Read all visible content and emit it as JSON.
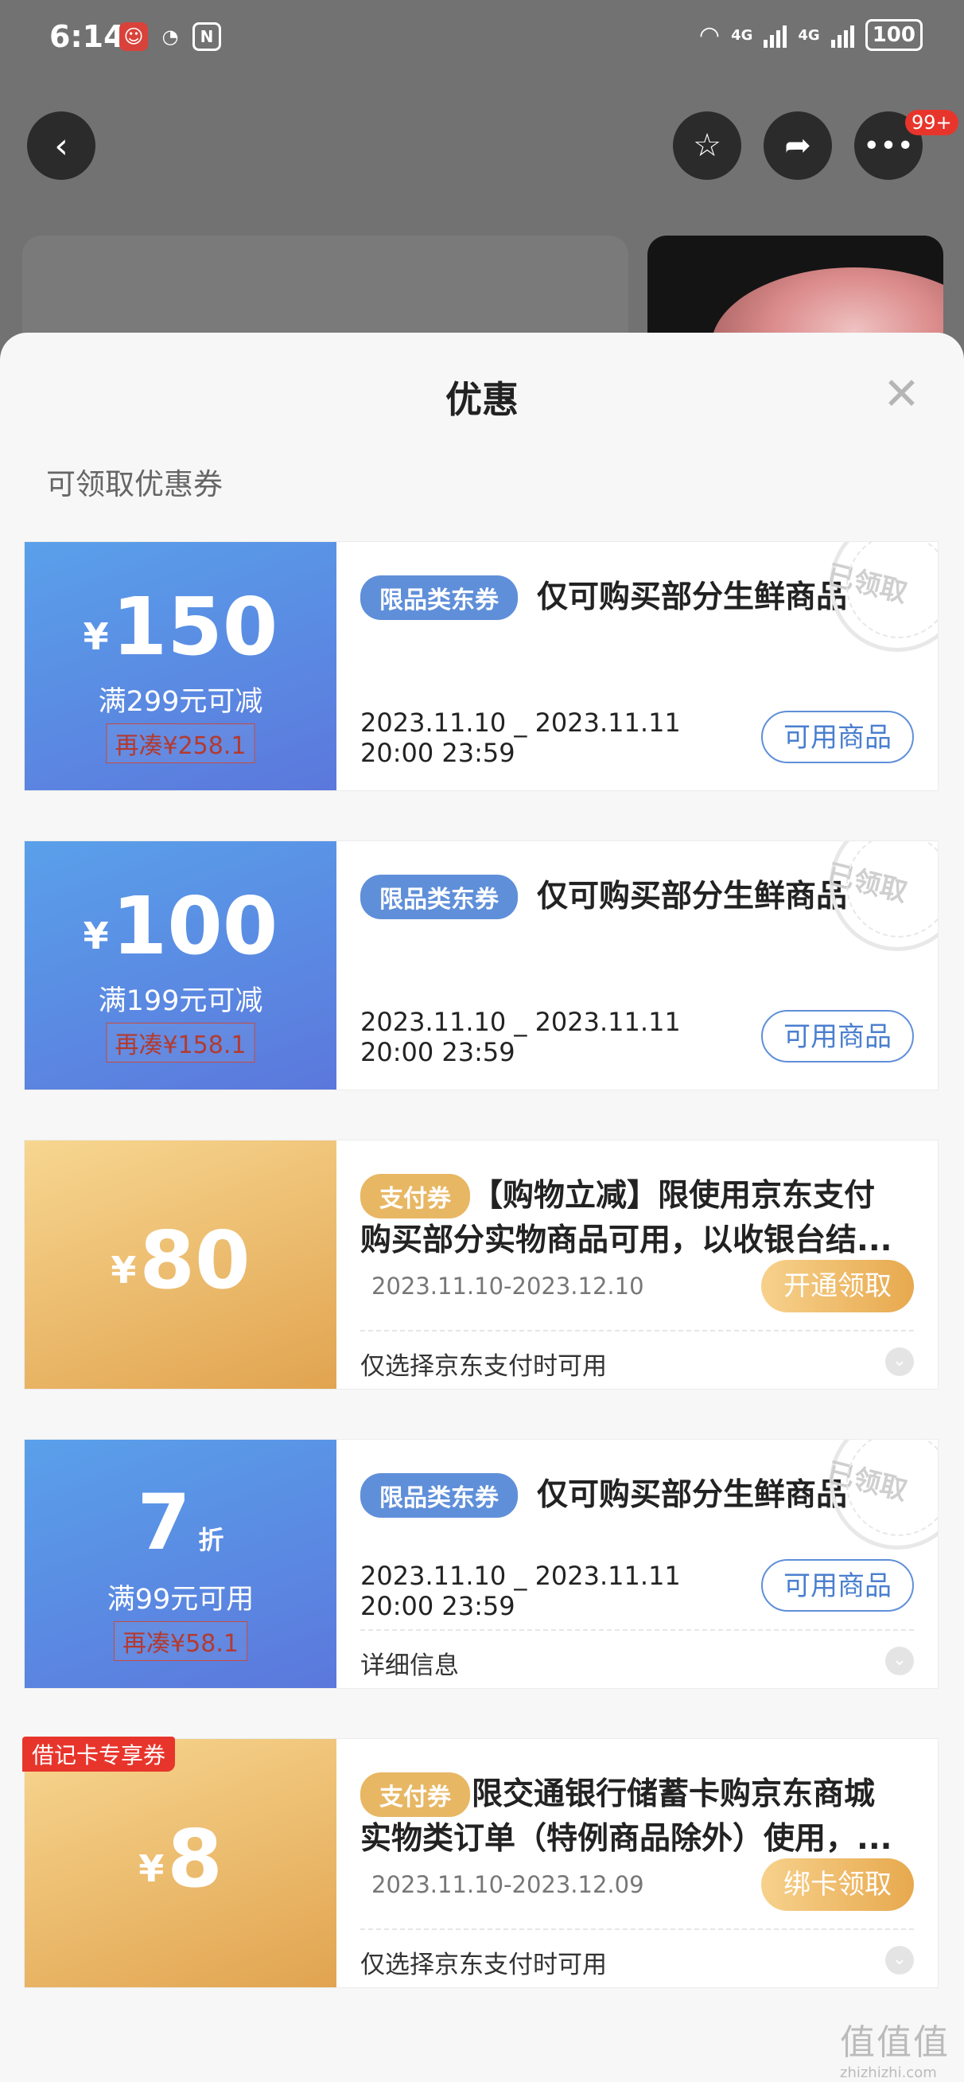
{
  "status_bar": {
    "time": "6:14",
    "app_icons": [
      "app-badge-icon",
      "speedometer-icon",
      "nfc-icon"
    ],
    "network_1": "4G",
    "network_2": "4G",
    "battery": "100"
  },
  "header": {
    "back_icon": "back-arrow-icon",
    "favorite_icon": "star-icon",
    "share_icon": "share-icon",
    "more_icon": "more-dots-icon",
    "more_badge": "99+"
  },
  "sheet": {
    "title": "优惠",
    "close_icon": "close-icon",
    "section_title": "可领取优惠券",
    "coupons": [
      {
        "currency": "¥",
        "amount": "150",
        "condition": "满299元可减",
        "gap": "再凑¥258.1",
        "tag": "限品类东券",
        "title": "仅可购买部分生鲜商品",
        "date_line1": "2023.11.10 _ 2023.11.11",
        "date_line2": "20:00 23:59",
        "button": "可用商品",
        "stamp": "已领取"
      },
      {
        "currency": "¥",
        "amount": "100",
        "condition": "满199元可减",
        "gap": "再凑¥158.1",
        "tag": "限品类东券",
        "title": "仅可购买部分生鲜商品",
        "date_line1": "2023.11.10 _ 2023.11.11",
        "date_line2": "20:00 23:59",
        "button": "可用商品",
        "stamp": "已领取"
      },
      {
        "currency": "¥",
        "amount": "80",
        "tag": "支付券",
        "title_line1": "【购物立减】限使用京东支付",
        "title_line2": "购买部分实物商品可用，以收银台结...",
        "date": "2023.11.10-2023.12.10",
        "button": "开通领取",
        "note": "仅选择京东支付时可用"
      },
      {
        "amount": "7",
        "unit": "折",
        "condition": "满99元可用",
        "gap": "再凑¥58.1",
        "tag": "限品类东券",
        "title": "仅可购买部分生鲜商品",
        "date_line1": "2023.11.10 _ 2023.11.11",
        "date_line2": "20:00 23:59",
        "button": "可用商品",
        "note": "详细信息",
        "stamp": "已领取"
      },
      {
        "corner_tag": "借记卡专享券",
        "currency": "¥",
        "amount": "8",
        "tag": "支付券",
        "title_line1": "限交通银行储蓄卡购京东商城",
        "title_line2": "实物类订单（特例商品除外）使用，...",
        "date": "2023.11.10-2023.12.09",
        "button": "绑卡领取",
        "note": "仅选择京东支付时可用"
      }
    ]
  },
  "watermark": {
    "logo": "值值值",
    "url": "zhizhizhi.com"
  }
}
